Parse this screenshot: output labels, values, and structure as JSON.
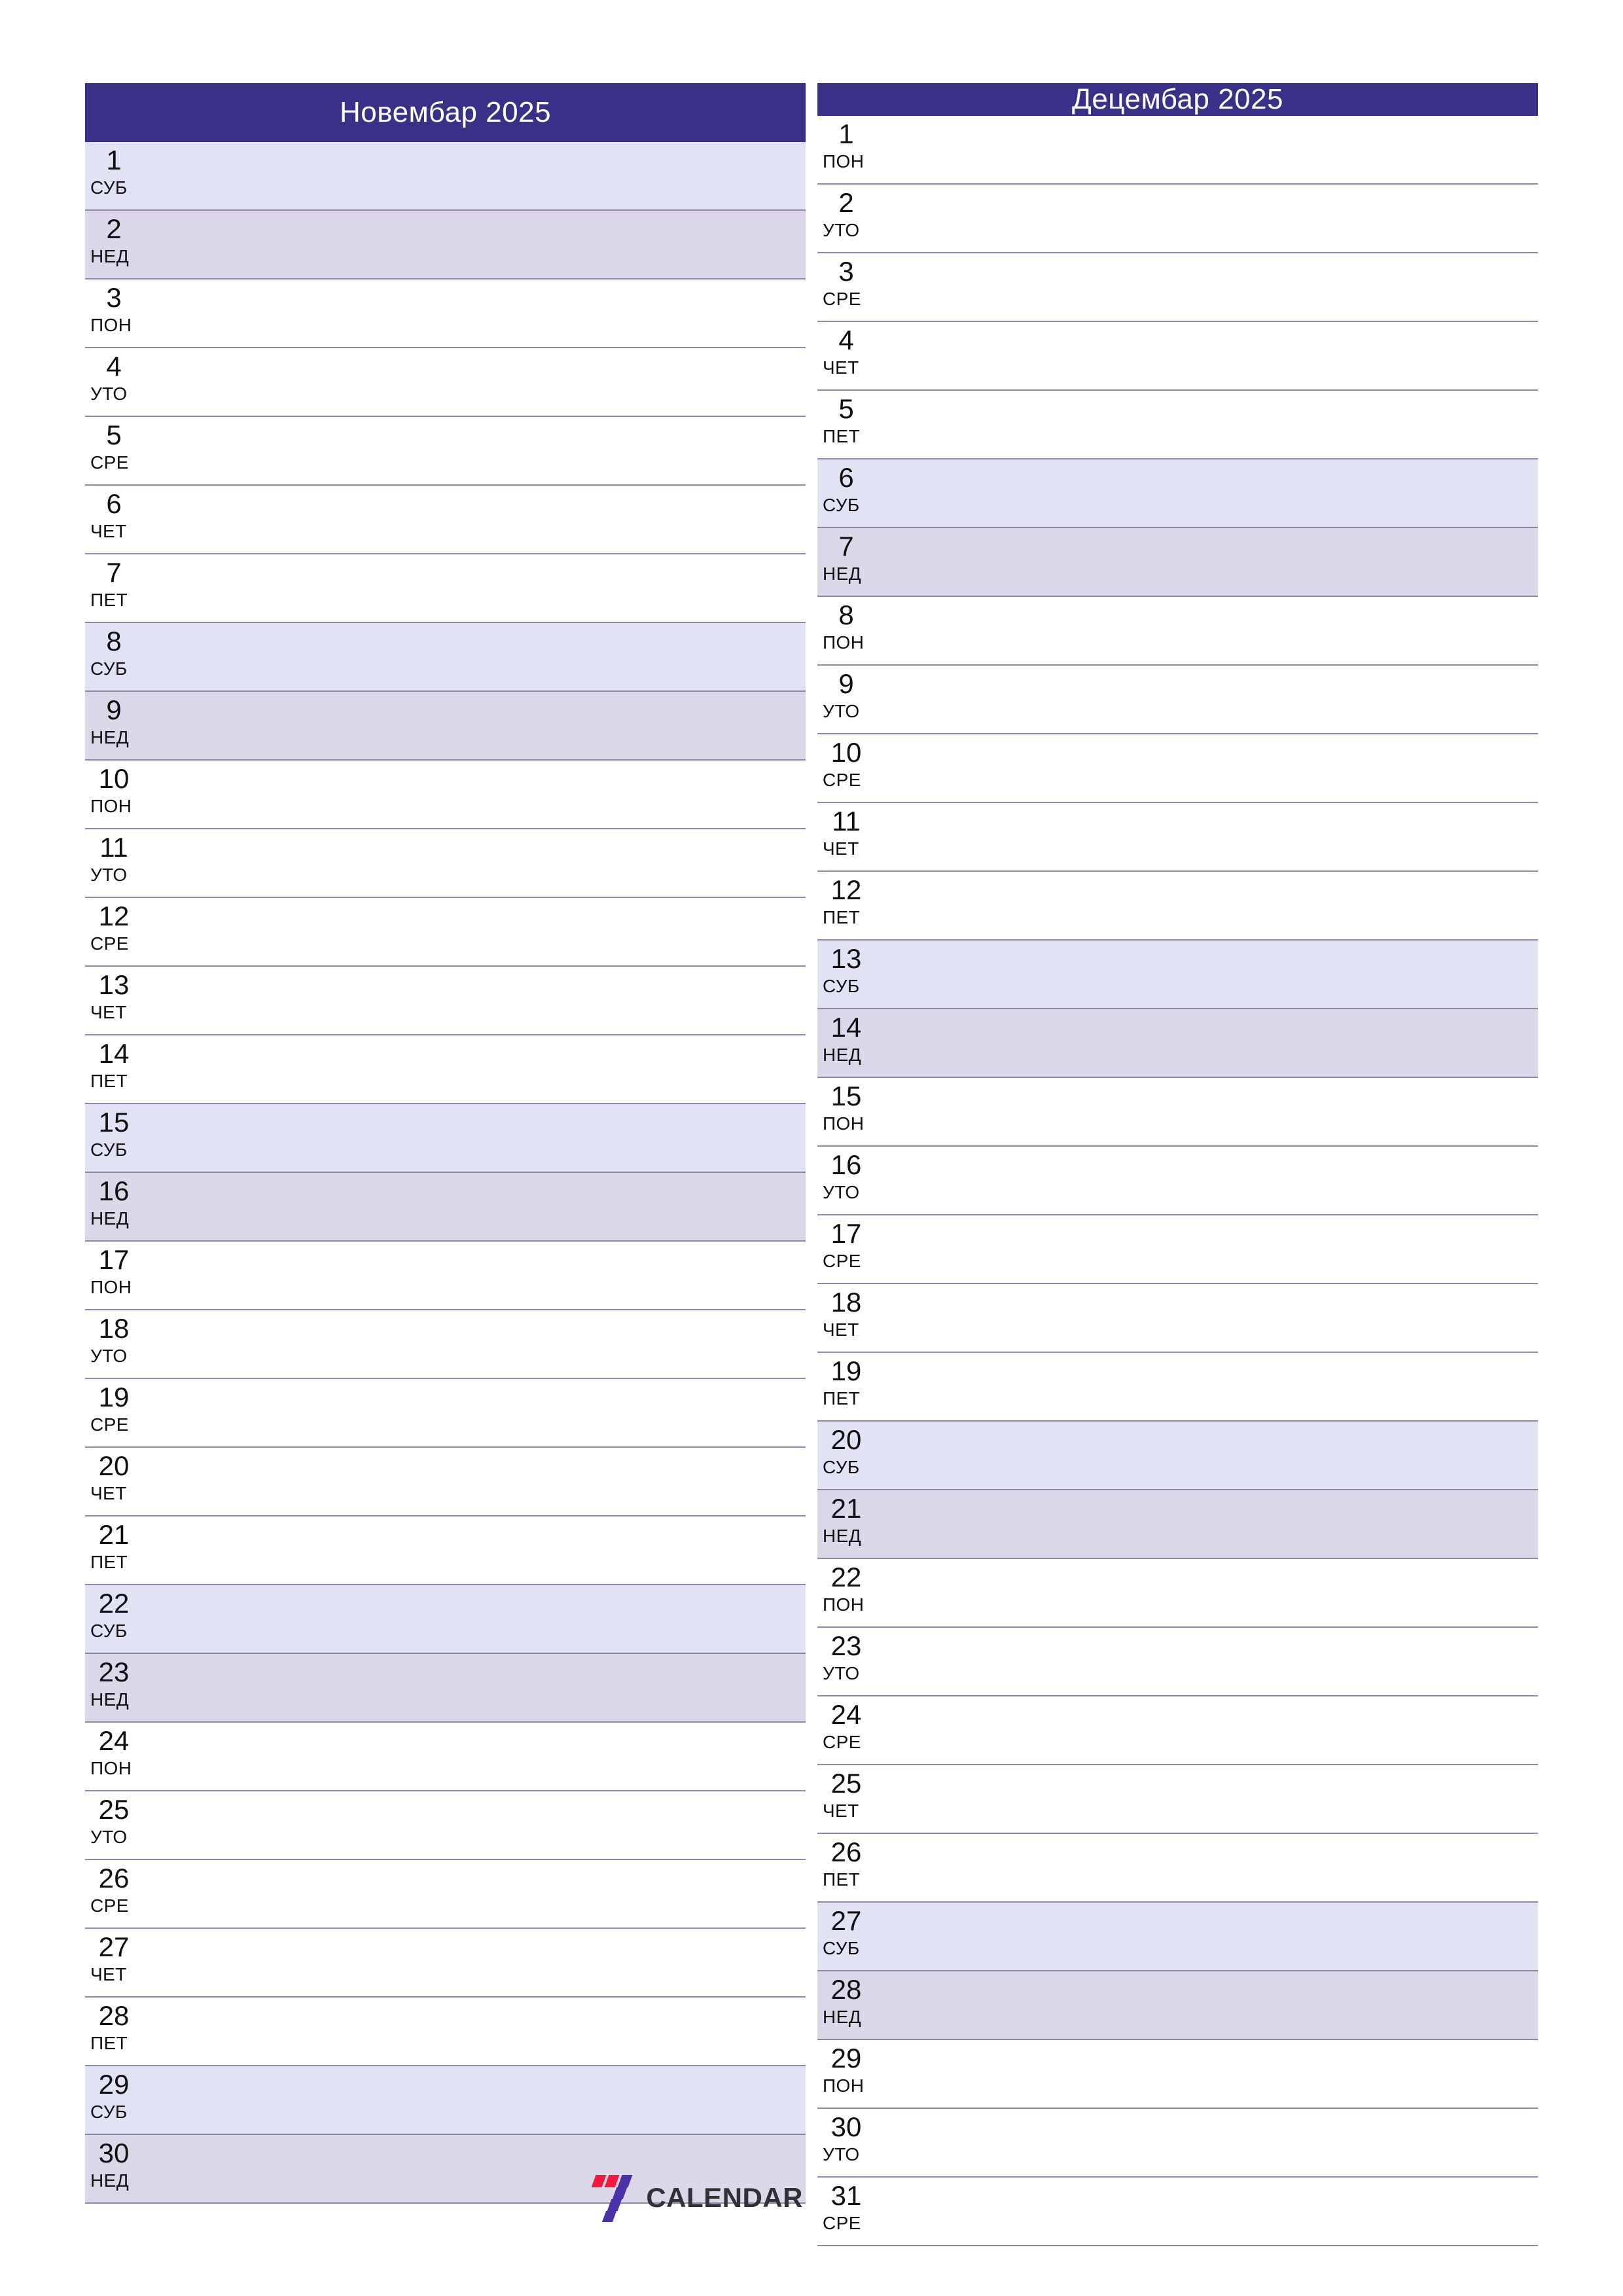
{
  "colors": {
    "header_bg": "#393087",
    "header_text": "#ffffff",
    "saturday_bg": "#e2e2f5",
    "sunday_bg": "#dcd8ea",
    "grid_line": "#8a8aa9",
    "logo_red": "#f5173e",
    "logo_purple": "#4b31a8",
    "logo_text": "#313136",
    "page_bg": "#ffffff"
  },
  "footer": {
    "logo_word": "CALENDAR",
    "logo_digit": "7"
  },
  "months": [
    {
      "title": "Новембар 2025",
      "days": [
        {
          "num": "1",
          "abbr": "СУБ",
          "type": "sat"
        },
        {
          "num": "2",
          "abbr": "НЕД",
          "type": "sun"
        },
        {
          "num": "3",
          "abbr": "ПОН",
          "type": "wd"
        },
        {
          "num": "4",
          "abbr": "УТО",
          "type": "wd"
        },
        {
          "num": "5",
          "abbr": "СРЕ",
          "type": "wd"
        },
        {
          "num": "6",
          "abbr": "ЧЕТ",
          "type": "wd"
        },
        {
          "num": "7",
          "abbr": "ПЕТ",
          "type": "wd"
        },
        {
          "num": "8",
          "abbr": "СУБ",
          "type": "sat"
        },
        {
          "num": "9",
          "abbr": "НЕД",
          "type": "sun"
        },
        {
          "num": "10",
          "abbr": "ПОН",
          "type": "wd"
        },
        {
          "num": "11",
          "abbr": "УТО",
          "type": "wd"
        },
        {
          "num": "12",
          "abbr": "СРЕ",
          "type": "wd"
        },
        {
          "num": "13",
          "abbr": "ЧЕТ",
          "type": "wd"
        },
        {
          "num": "14",
          "abbr": "ПЕТ",
          "type": "wd"
        },
        {
          "num": "15",
          "abbr": "СУБ",
          "type": "sat"
        },
        {
          "num": "16",
          "abbr": "НЕД",
          "type": "sun"
        },
        {
          "num": "17",
          "abbr": "ПОН",
          "type": "wd"
        },
        {
          "num": "18",
          "abbr": "УТО",
          "type": "wd"
        },
        {
          "num": "19",
          "abbr": "СРЕ",
          "type": "wd"
        },
        {
          "num": "20",
          "abbr": "ЧЕТ",
          "type": "wd"
        },
        {
          "num": "21",
          "abbr": "ПЕТ",
          "type": "wd"
        },
        {
          "num": "22",
          "abbr": "СУБ",
          "type": "sat"
        },
        {
          "num": "23",
          "abbr": "НЕД",
          "type": "sun"
        },
        {
          "num": "24",
          "abbr": "ПОН",
          "type": "wd"
        },
        {
          "num": "25",
          "abbr": "УТО",
          "type": "wd"
        },
        {
          "num": "26",
          "abbr": "СРЕ",
          "type": "wd"
        },
        {
          "num": "27",
          "abbr": "ЧЕТ",
          "type": "wd"
        },
        {
          "num": "28",
          "abbr": "ПЕТ",
          "type": "wd"
        },
        {
          "num": "29",
          "abbr": "СУБ",
          "type": "sat"
        },
        {
          "num": "30",
          "abbr": "НЕД",
          "type": "sun"
        }
      ]
    },
    {
      "title": "Децембар 2025",
      "days": [
        {
          "num": "1",
          "abbr": "ПОН",
          "type": "wd"
        },
        {
          "num": "2",
          "abbr": "УТО",
          "type": "wd"
        },
        {
          "num": "3",
          "abbr": "СРЕ",
          "type": "wd"
        },
        {
          "num": "4",
          "abbr": "ЧЕТ",
          "type": "wd"
        },
        {
          "num": "5",
          "abbr": "ПЕТ",
          "type": "wd"
        },
        {
          "num": "6",
          "abbr": "СУБ",
          "type": "sat"
        },
        {
          "num": "7",
          "abbr": "НЕД",
          "type": "sun"
        },
        {
          "num": "8",
          "abbr": "ПОН",
          "type": "wd"
        },
        {
          "num": "9",
          "abbr": "УТО",
          "type": "wd"
        },
        {
          "num": "10",
          "abbr": "СРЕ",
          "type": "wd"
        },
        {
          "num": "11",
          "abbr": "ЧЕТ",
          "type": "wd"
        },
        {
          "num": "12",
          "abbr": "ПЕТ",
          "type": "wd"
        },
        {
          "num": "13",
          "abbr": "СУБ",
          "type": "sat"
        },
        {
          "num": "14",
          "abbr": "НЕД",
          "type": "sun"
        },
        {
          "num": "15",
          "abbr": "ПОН",
          "type": "wd"
        },
        {
          "num": "16",
          "abbr": "УТО",
          "type": "wd"
        },
        {
          "num": "17",
          "abbr": "СРЕ",
          "type": "wd"
        },
        {
          "num": "18",
          "abbr": "ЧЕТ",
          "type": "wd"
        },
        {
          "num": "19",
          "abbr": "ПЕТ",
          "type": "wd"
        },
        {
          "num": "20",
          "abbr": "СУБ",
          "type": "sat"
        },
        {
          "num": "21",
          "abbr": "НЕД",
          "type": "sun"
        },
        {
          "num": "22",
          "abbr": "ПОН",
          "type": "wd"
        },
        {
          "num": "23",
          "abbr": "УТО",
          "type": "wd"
        },
        {
          "num": "24",
          "abbr": "СРЕ",
          "type": "wd"
        },
        {
          "num": "25",
          "abbr": "ЧЕТ",
          "type": "wd"
        },
        {
          "num": "26",
          "abbr": "ПЕТ",
          "type": "wd"
        },
        {
          "num": "27",
          "abbr": "СУБ",
          "type": "sat"
        },
        {
          "num": "28",
          "abbr": "НЕД",
          "type": "sun"
        },
        {
          "num": "29",
          "abbr": "ПОН",
          "type": "wd"
        },
        {
          "num": "30",
          "abbr": "УТО",
          "type": "wd"
        },
        {
          "num": "31",
          "abbr": "СРЕ",
          "type": "wd"
        }
      ]
    }
  ]
}
